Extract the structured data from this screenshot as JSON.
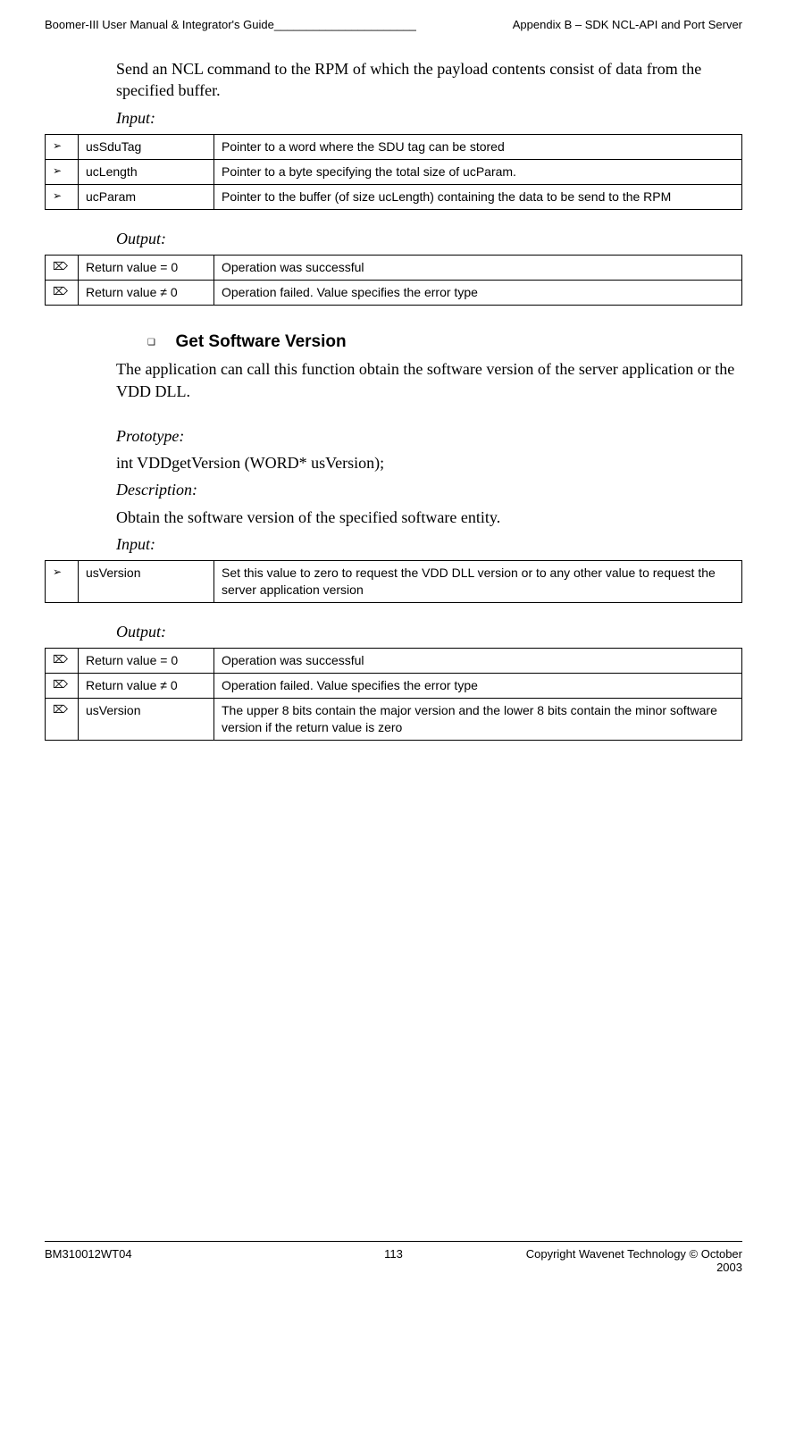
{
  "header": {
    "left": "Boomer-III User Manual & Integrator's Guide______________________",
    "right": "Appendix B – SDK NCL-API and Port Server"
  },
  "section1": {
    "intro": "Send an NCL command to the RPM of which the payload contents consist of data from the specified buffer.",
    "input_label": "Input",
    "input_rows": [
      {
        "arrow": "➢",
        "key": "usSduTag",
        "desc": "Pointer to a word where the SDU tag can be stored"
      },
      {
        "arrow": "➢",
        "key": "ucLength",
        "desc": "Pointer to a byte specifying the total size of ucParam."
      },
      {
        "arrow": "➢",
        "key": "ucParam",
        "desc": "Pointer to the buffer (of size ucLength) containing the data to be send to the RPM"
      }
    ],
    "output_label": "Output:",
    "output_rows": [
      {
        "arrow": "⌦",
        "key": "Return value = 0",
        "desc": "Operation was successful"
      },
      {
        "arrow": "⌦",
        "key": "Return value  ≠ 0",
        "desc": "Operation failed. Value specifies the error type"
      }
    ]
  },
  "section2": {
    "heading": "Get Software Version",
    "intro": "The application can call this function obtain the software version of the server application or the VDD DLL.",
    "proto_label": "Prototype:",
    "proto": "int VDDgetVersion (WORD* usVersion);",
    "desc_label": "Description:",
    "desc": "Obtain the software version of the specified software entity.",
    "input_label": "Input",
    "input_rows": [
      {
        "arrow": "➢",
        "key": "usVersion",
        "desc": "Set this value to zero to request the VDD DLL version or to any other value to request the server application version"
      }
    ],
    "output_label": "Output:",
    "output_rows": [
      {
        "arrow": "⌦",
        "key": "Return value = 0",
        "desc": "Operation was successful"
      },
      {
        "arrow": "⌦",
        "key": "Return value  ≠ 0",
        "desc": "Operation failed. Value specifies the error type"
      },
      {
        "arrow": "⌦",
        "key": "usVersion",
        "desc": "The upper 8 bits contain the major version and the lower 8 bits contain the minor software version if the return value is zero"
      }
    ]
  },
  "footer": {
    "left": "BM310012WT04",
    "center": "113",
    "right": "Copyright Wavenet Technology © October 2003"
  }
}
